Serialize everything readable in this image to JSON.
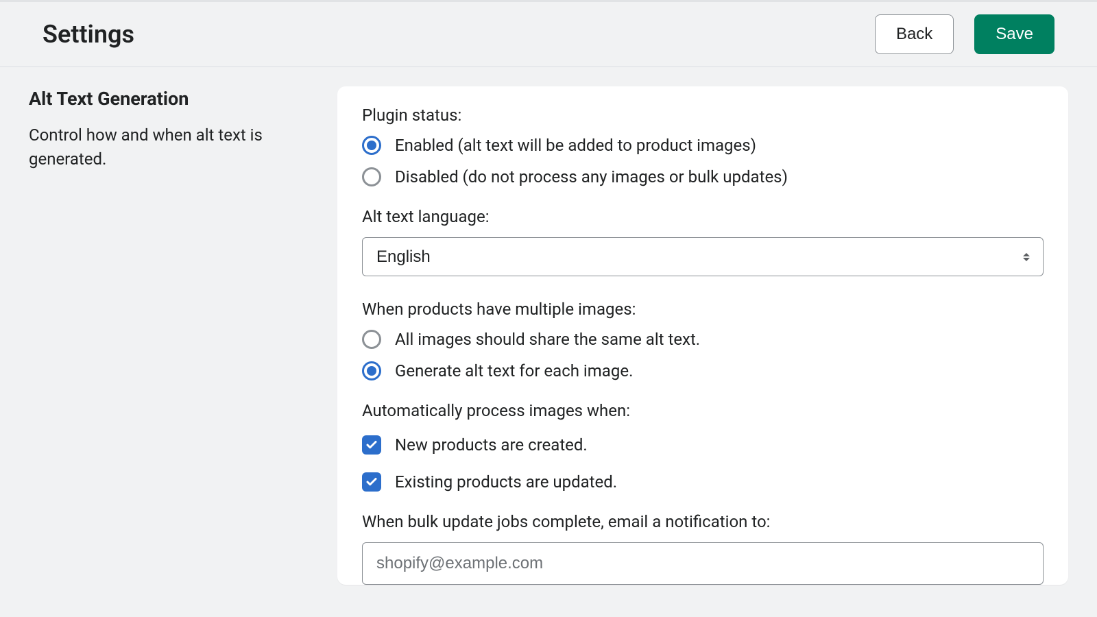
{
  "header": {
    "title": "Settings",
    "back_label": "Back",
    "save_label": "Save"
  },
  "sidebar": {
    "section_title": "Alt Text Generation",
    "section_desc": "Control how and when alt text is generated."
  },
  "form": {
    "plugin_status": {
      "label": "Plugin status:",
      "options": [
        {
          "label": "Enabled (alt text will be added to product images)",
          "selected": true
        },
        {
          "label": "Disabled (do not process any images or bulk updates)",
          "selected": false
        }
      ]
    },
    "language": {
      "label": "Alt text language:",
      "selected": "English"
    },
    "multi_image": {
      "label": "When products have multiple images:",
      "options": [
        {
          "label": "All images should share the same alt text.",
          "selected": false
        },
        {
          "label": "Generate alt text for each image.",
          "selected": true
        }
      ]
    },
    "auto_process": {
      "label": "Automatically process images when:",
      "options": [
        {
          "label": "New products are created.",
          "checked": true
        },
        {
          "label": "Existing products are updated.",
          "checked": true
        }
      ]
    },
    "notify": {
      "label": "When bulk update jobs complete, email a notification to:",
      "value": "shopify@example.com"
    }
  }
}
